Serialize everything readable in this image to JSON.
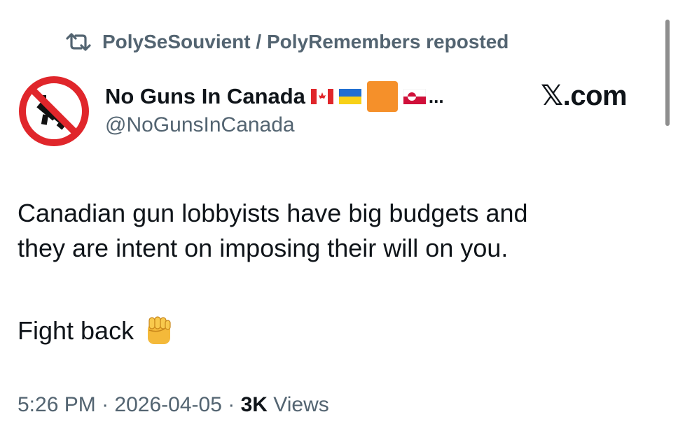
{
  "repost": {
    "text": "PolySeSouvient / PolyRemembers reposted",
    "icon": "repost-icon"
  },
  "author": {
    "name": "No Guns In Canada",
    "flags": [
      "flag-canada",
      "flag-ukraine",
      "orange-square",
      "flag-greenland"
    ],
    "ellipsis": "...",
    "handle": "@NoGunsInCanada",
    "avatar_icon": "no-guns-icon"
  },
  "source": {
    "label": "𝕏.com"
  },
  "post": {
    "line1": "Canadian gun lobbyists have big budgets and",
    "line2": "they are intent on imposing their will on you.",
    "line3": "Fight back",
    "emoji": "raised-fist-icon"
  },
  "meta": {
    "time": "5:26 PM",
    "sep1": "·",
    "date": "2026-04-05",
    "sep2": "·",
    "views_count": "3K",
    "views_label": "Views"
  },
  "colors": {
    "text": "#0f1419",
    "secondary": "#536471",
    "prohibition_red": "#e0262b"
  }
}
